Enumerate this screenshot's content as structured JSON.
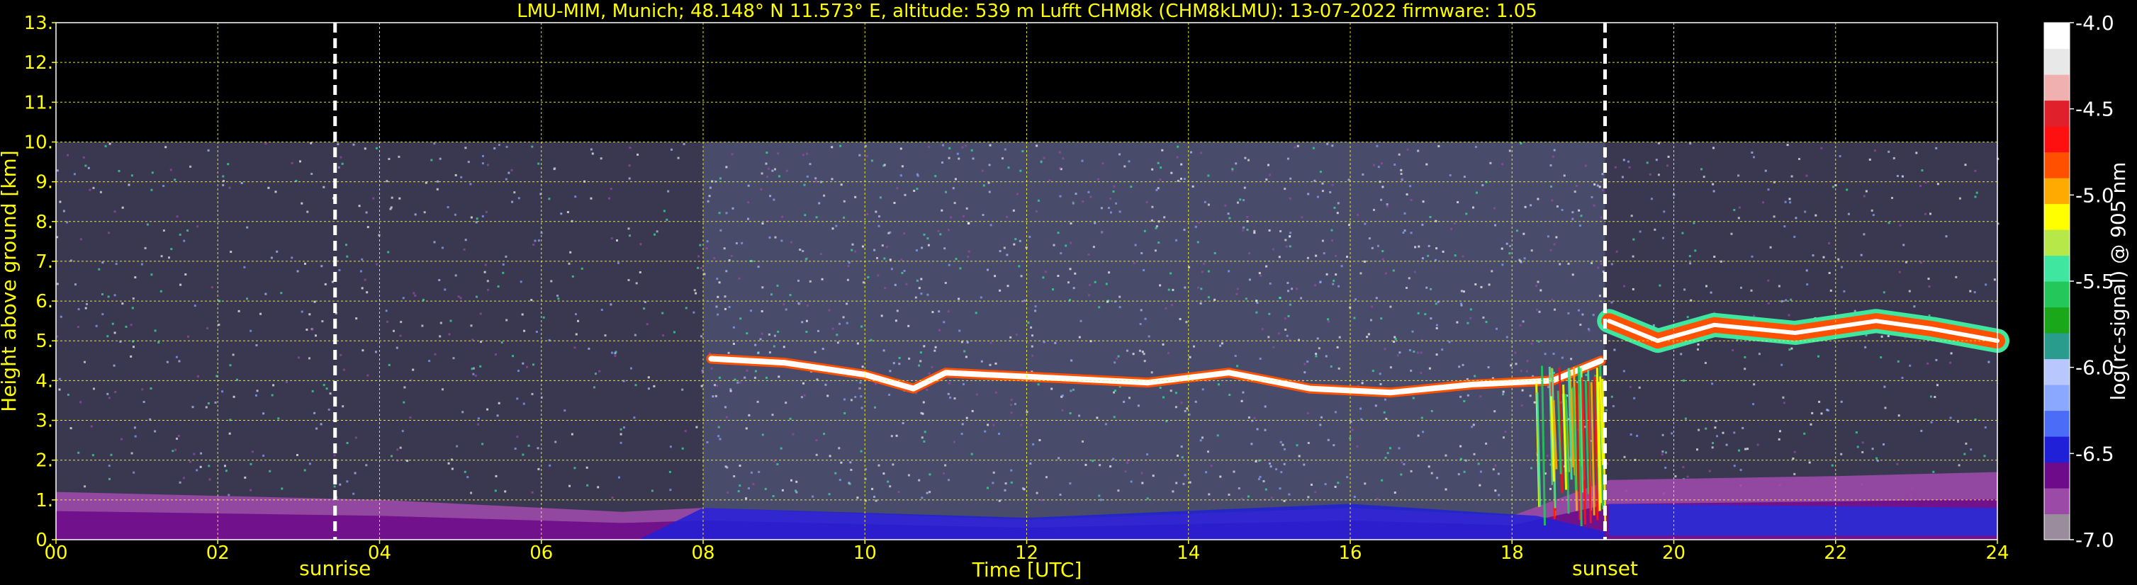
{
  "chart_data": {
    "type": "heatmap",
    "title": "LMU-MIM, Munich; 48.148° N 11.573° E, altitude: 539 m    Lufft CHM8k (CHM8kLMU): 13-07-2022    firmware: 1.05",
    "xlabel": "Time [UTC]",
    "ylabel": "Height above ground [km]",
    "xlim": [
      0,
      24
    ],
    "ylim": [
      0,
      13
    ],
    "x_ticks": [
      "00",
      "02",
      "04",
      "06",
      "08",
      "10",
      "12",
      "14",
      "16",
      "18",
      "20",
      "22",
      "24"
    ],
    "y_ticks": [
      "0.",
      "1.",
      "2.",
      "3.",
      "4.",
      "5.",
      "6.",
      "7.",
      "8.",
      "9.",
      "10.",
      "11.",
      "12.",
      "13."
    ],
    "grid": true,
    "data_top_km": 10,
    "markers": [
      {
        "label": "sunrise",
        "x": 3.45
      },
      {
        "label": "sunset",
        "x": 19.15
      }
    ],
    "features": {
      "cloud_layer_upper": [
        [
          8.1,
          4.55
        ],
        [
          9.0,
          4.45
        ],
        [
          10.0,
          4.15
        ],
        [
          10.6,
          3.8
        ],
        [
          11.0,
          4.2
        ],
        [
          12.0,
          4.1
        ],
        [
          13.5,
          3.95
        ],
        [
          14.5,
          4.2
        ],
        [
          15.5,
          3.8
        ],
        [
          16.5,
          3.7
        ],
        [
          17.5,
          3.9
        ],
        [
          18.5,
          4.0
        ],
        [
          19.1,
          4.5
        ]
      ],
      "cloud_layer_evening": [
        [
          19.2,
          5.5
        ],
        [
          19.8,
          5.0
        ],
        [
          20.5,
          5.4
        ],
        [
          21.5,
          5.2
        ],
        [
          22.5,
          5.5
        ],
        [
          23.2,
          5.3
        ],
        [
          24.0,
          5.0
        ]
      ],
      "boundary_layer_top": [
        [
          0,
          1.2
        ],
        [
          4,
          1.0
        ],
        [
          7,
          0.7
        ],
        [
          8,
          0.8
        ],
        [
          12,
          0.5
        ],
        [
          16,
          0.8
        ],
        [
          18,
          0.6
        ],
        [
          19.2,
          1.5
        ],
        [
          22,
          1.6
        ],
        [
          24,
          1.7
        ]
      ]
    },
    "colorbar": {
      "label": "log(rc-signal) @ 905 nm",
      "range": [
        -7.0,
        -4.0
      ],
      "ticks": [
        "-4.0",
        "-4.5",
        "-5.0",
        "-5.5",
        "-6.0",
        "-6.5",
        "-7.0"
      ],
      "colors": [
        "#9a8c9c",
        "#9c4aa8",
        "#6e0b8a",
        "#2020d8",
        "#4a6cf6",
        "#8aa8ff",
        "#b8c8ff",
        "#2a9c8e",
        "#1aa81a",
        "#24c85a",
        "#3ee6a0",
        "#b6e84a",
        "#ffff00",
        "#ffaa00",
        "#ff5000",
        "#ff1010",
        "#e0202a",
        "#f0b0b0",
        "#e8e8e8",
        "#ffffff"
      ]
    }
  }
}
